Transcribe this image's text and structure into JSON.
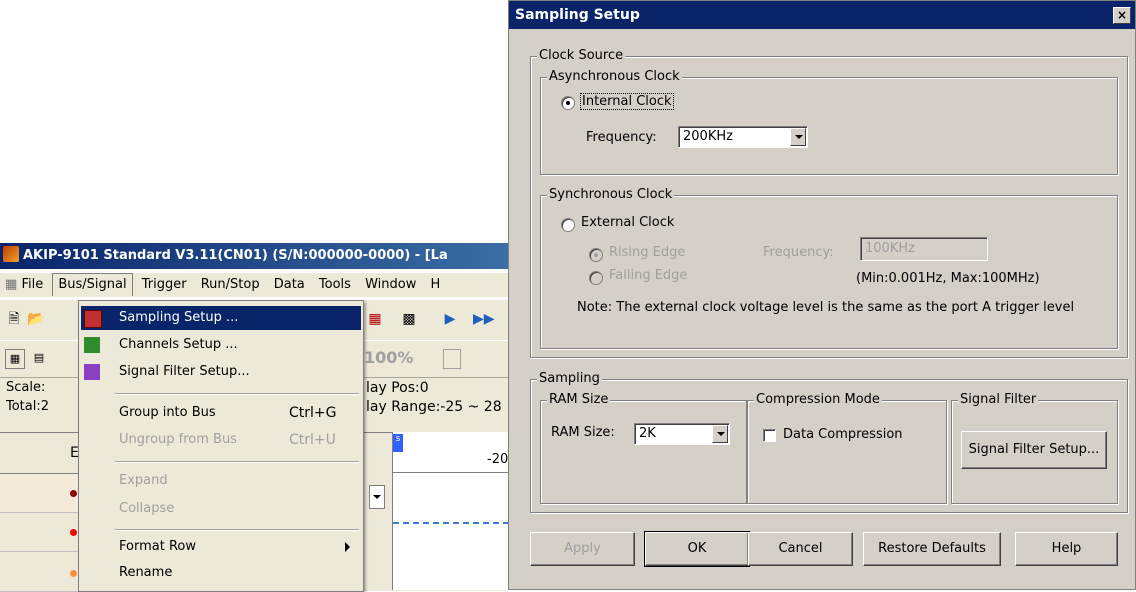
{
  "app": {
    "title": "AKIP-9101 Standard V3.11(CN01) (S/N:000000-0000) - [La",
    "menus": [
      {
        "label": "File",
        "underline": "F"
      },
      {
        "label": "Bus/Signal",
        "underline": "B"
      },
      {
        "label": "Trigger",
        "underline": "r"
      },
      {
        "label": "Run/Stop",
        "underline": "S"
      },
      {
        "label": "Data",
        "underline": "D"
      },
      {
        "label": "Tools",
        "underline": "T"
      },
      {
        "label": "Window",
        "underline": "W"
      },
      {
        "label": "H",
        "underline": "H"
      }
    ],
    "zoom": "100%",
    "scale_label": "Scale:",
    "total_label": "Total:2",
    "delay_pos": "lay Pos:0",
    "delay_range": "lay Range:-25 ~ 28",
    "col_header": "E",
    "ruler_tick": "-20",
    "ruler_marker": "s",
    "row_dots": [
      "#8b0000",
      "#ff0000",
      "#ff8c3c"
    ]
  },
  "dropdown": {
    "items": [
      {
        "label": "Sampling Setup ...",
        "icon": "sampling-setup-icon",
        "selected": true
      },
      {
        "label": "Channels Setup ...",
        "icon": "channels-setup-icon"
      },
      {
        "label": "Signal Filter Setup...",
        "icon": "signal-filter-icon"
      },
      {
        "label": "Group into Bus",
        "shortcut": "Ctrl+G"
      },
      {
        "label": "Ungroup from Bus",
        "shortcut": "Ctrl+U",
        "disabled": true
      },
      {
        "label": "Expand",
        "disabled": true
      },
      {
        "label": "Collapse",
        "disabled": true
      },
      {
        "label": "Format Row",
        "submenu": true
      },
      {
        "label": "Rename"
      }
    ]
  },
  "dialog": {
    "title": "Sampling Setup",
    "close": "×",
    "clock_source": "Clock Source",
    "async_clock": "Asynchronous Clock",
    "internal_clock": "Internal Clock",
    "frequency_label": "Frequency:",
    "frequency_value": "200KHz",
    "sync_clock": "Synchronous Clock",
    "external_clock": "External Clock",
    "rising_edge": "Rising Edge",
    "falling_edge": "Falling Edge",
    "ext_frequency_label": "Frequency:",
    "ext_frequency_value": "100KHz",
    "ext_range": "(Min:0.001Hz, Max:100MHz)",
    "note": "Note: The external clock voltage level is the same as the port A trigger level",
    "sampling": "Sampling",
    "ram_size_group": "RAM Size",
    "ram_size_label": "RAM Size:",
    "ram_size_value": "2K",
    "compression_group": "Compression Mode",
    "data_compression": "Data Compression",
    "signal_filter_group": "Signal Filter",
    "signal_filter_button": "Signal Filter Setup...",
    "buttons": {
      "apply": "Apply",
      "ok": "OK",
      "cancel": "Cancel",
      "restore": "Restore Defaults",
      "help": "Help"
    }
  }
}
